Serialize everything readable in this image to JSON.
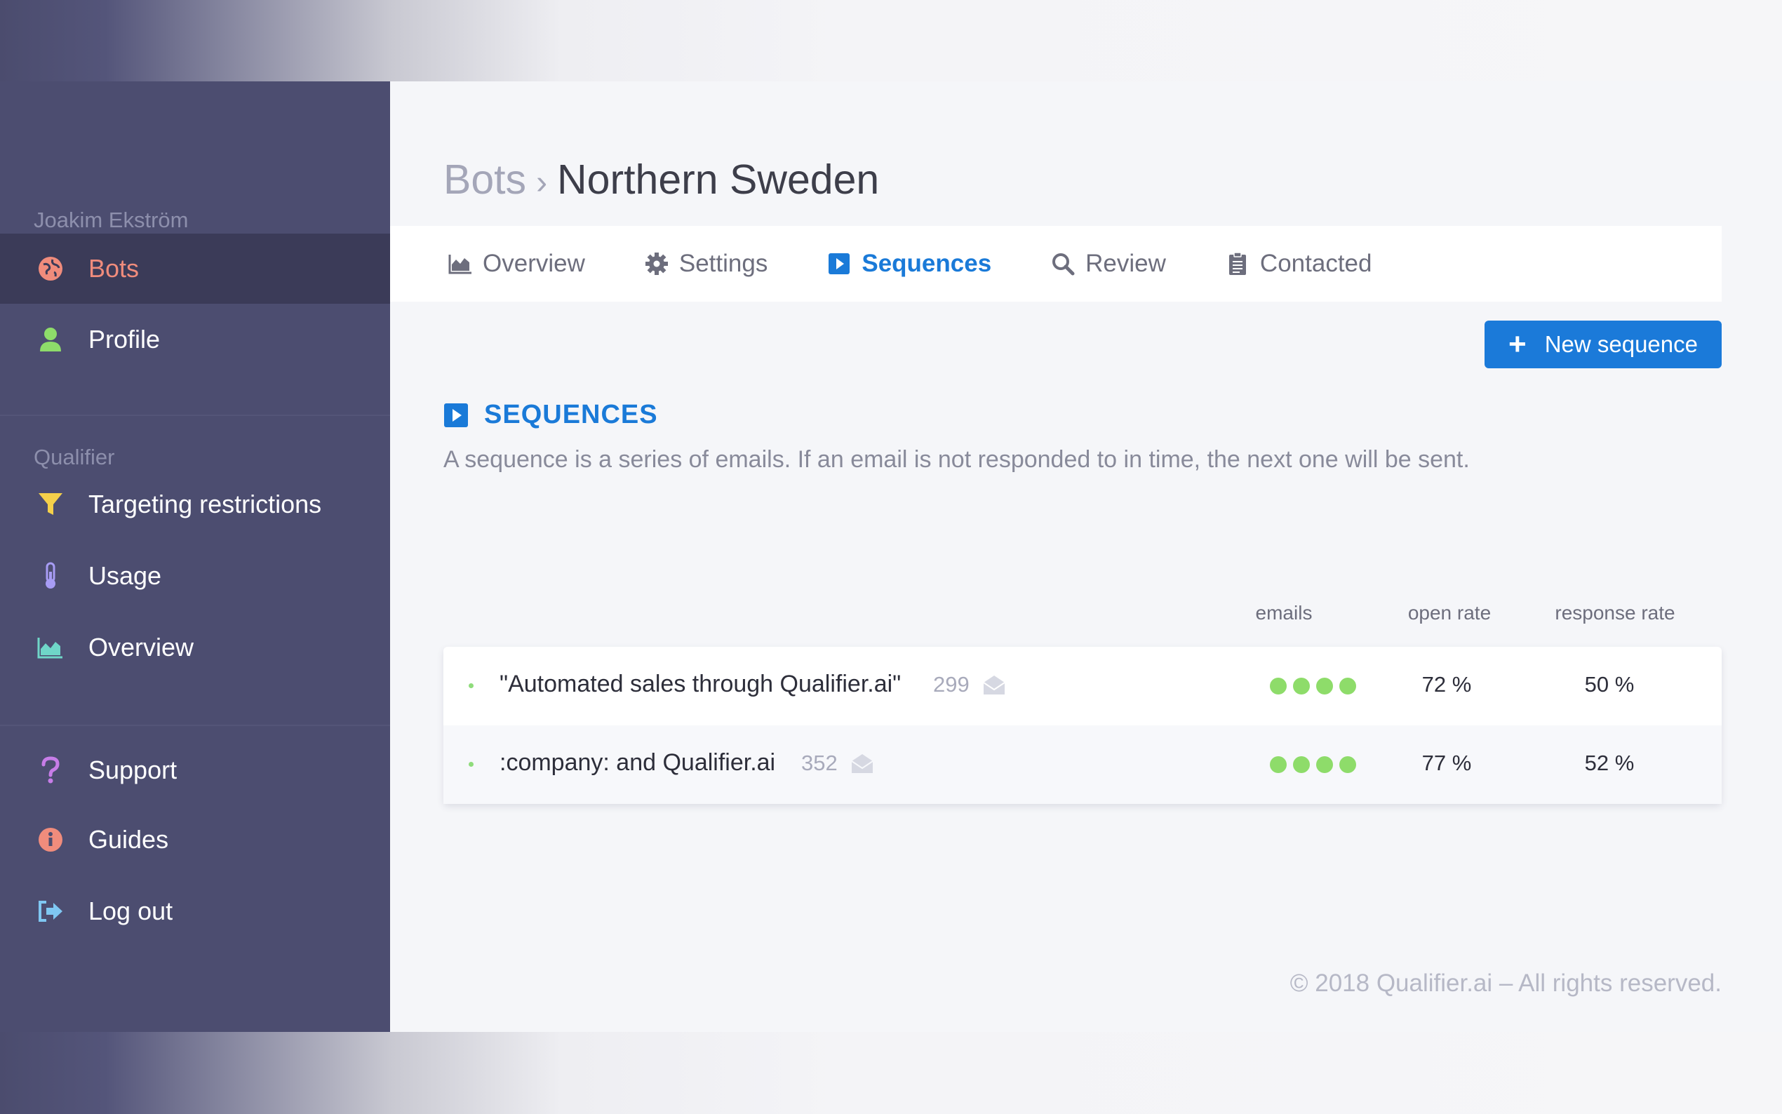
{
  "sidebar": {
    "user_name": "Joakim Ekström",
    "section_qualifier": "Qualifier",
    "items": [
      {
        "label": "Bots",
        "icon": "globe-icon",
        "color": "#f08c7c",
        "active": true
      },
      {
        "label": "Profile",
        "icon": "user-icon",
        "color": "#8edc6a"
      },
      {
        "label": "Targeting restrictions",
        "icon": "filter-icon",
        "color": "#f5d04a"
      },
      {
        "label": "Usage",
        "icon": "thermometer-icon",
        "color": "#a79cf5"
      },
      {
        "label": "Overview",
        "icon": "area-chart-icon",
        "color": "#6fd6c8"
      },
      {
        "label": "Support",
        "icon": "question-icon",
        "color": "#c77de8"
      },
      {
        "label": "Guides",
        "icon": "info-icon",
        "color": "#f08c7c"
      },
      {
        "label": "Log out",
        "icon": "logout-icon",
        "color": "#7fc7f2"
      }
    ]
  },
  "breadcrumb": {
    "root": "Bots",
    "separator": "›",
    "current": "Northern Sweden"
  },
  "tabs": [
    {
      "label": "Overview",
      "icon": "area-chart-icon"
    },
    {
      "label": "Settings",
      "icon": "gear-icon"
    },
    {
      "label": "Sequences",
      "icon": "play-square-icon",
      "active": true
    },
    {
      "label": "Review",
      "icon": "search-icon"
    },
    {
      "label": "Contacted",
      "icon": "clipboard-icon"
    }
  ],
  "new_button": {
    "label": "New sequence",
    "icon": "plus-icon"
  },
  "section": {
    "title": "SEQUENCES",
    "description": "A sequence is a series of emails. If an email is not responded to in time, the next one will be sent."
  },
  "table": {
    "headers": {
      "emails": "emails",
      "open_rate": "open rate",
      "response_rate": "response rate"
    },
    "rows": [
      {
        "name": "\"Automated sales through Qualifier.ai\"",
        "count": "299",
        "emails": 4,
        "open_rate": "72 %",
        "response_rate": "50 %"
      },
      {
        "name": ":company: and Qualifier.ai",
        "count": "352",
        "emails": 4,
        "open_rate": "77 %",
        "response_rate": "52 %"
      }
    ]
  },
  "footer": "© 2018 Qualifier.ai – All rights reserved.",
  "colors": {
    "accent": "#1b7ad9",
    "sidebar_bg": "#4c4d70",
    "active_item": "#f08c7c",
    "email_dot": "#8edc6a"
  }
}
